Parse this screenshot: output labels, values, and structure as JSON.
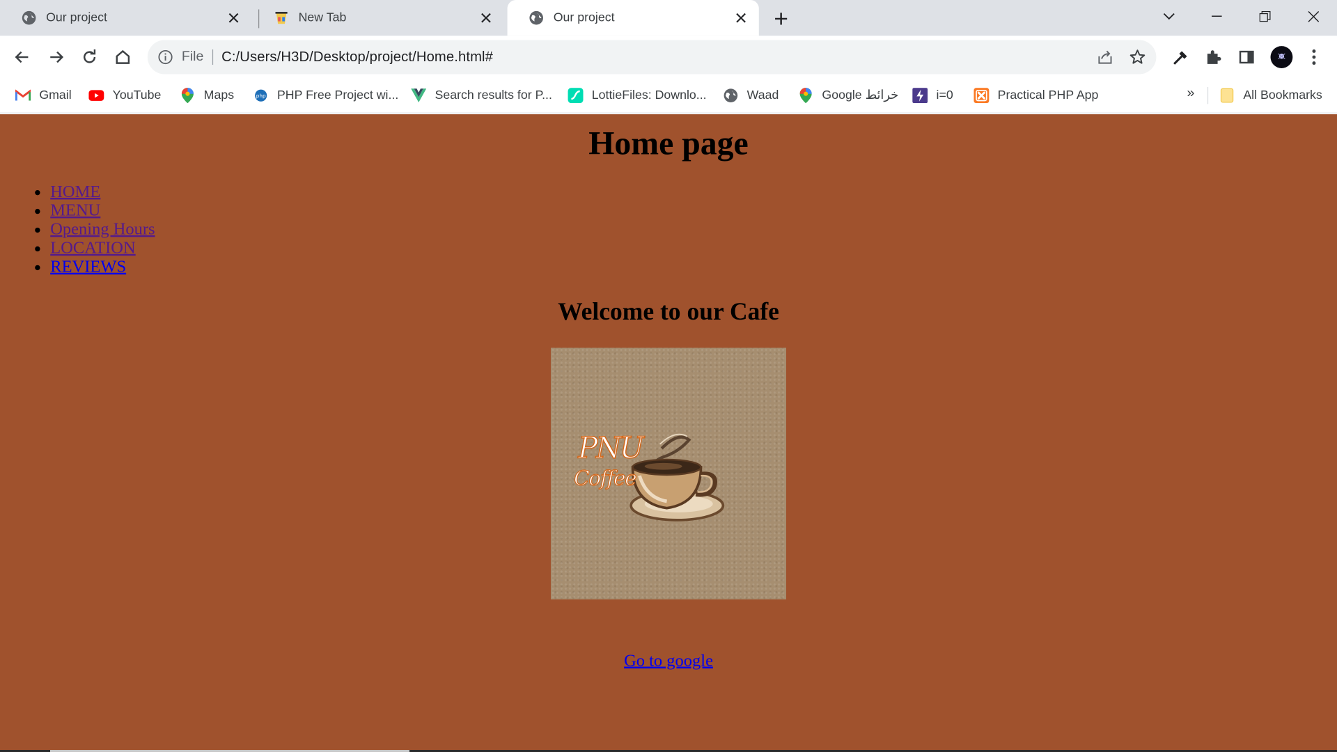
{
  "tabs": [
    {
      "title": "Our project",
      "icon": "globe-icon"
    },
    {
      "title": "New Tab",
      "icon": "new-tab-favicon"
    },
    {
      "title": "Our project",
      "icon": "globe-icon",
      "active": true
    }
  ],
  "omnibox": {
    "scheme_label": "File",
    "url": "C:/Users/H3D/Desktop/project/Home.html#"
  },
  "bookmarks": [
    {
      "label": "Gmail",
      "icon": "gmail-icon"
    },
    {
      "label": "YouTube",
      "icon": "youtube-icon"
    },
    {
      "label": "Maps",
      "icon": "maps-pin-icon"
    },
    {
      "label": "PHP Free Project wi...",
      "icon": "php-icon"
    },
    {
      "label": "Search results for P...",
      "icon": "vue-icon"
    },
    {
      "label": "LottieFiles: Downlo...",
      "icon": "lottie-icon"
    },
    {
      "label": "Waad",
      "icon": "globe-icon"
    },
    {
      "label": "Google خرائط",
      "icon": "maps-pin-icon"
    },
    {
      "label": "i=0",
      "icon": "bolt-icon"
    },
    {
      "label": "Practical PHP App",
      "icon": "xampp-icon"
    }
  ],
  "bookmarks_overflow": "»",
  "all_bookmarks": "All Bookmarks",
  "page": {
    "title": "Home page",
    "nav": [
      "HOME",
      "MENU",
      "Opening Hours",
      "LOCATION",
      "REVIEWS"
    ],
    "welcome": "Welcome to our Cafe",
    "logo_text_line1": "PNU",
    "logo_text_line2": "Coffee",
    "google_link": "Go to google"
  },
  "colors": {
    "page_background": "#a0522d",
    "visited_link": "#551a8b",
    "link": "#0000ee"
  }
}
